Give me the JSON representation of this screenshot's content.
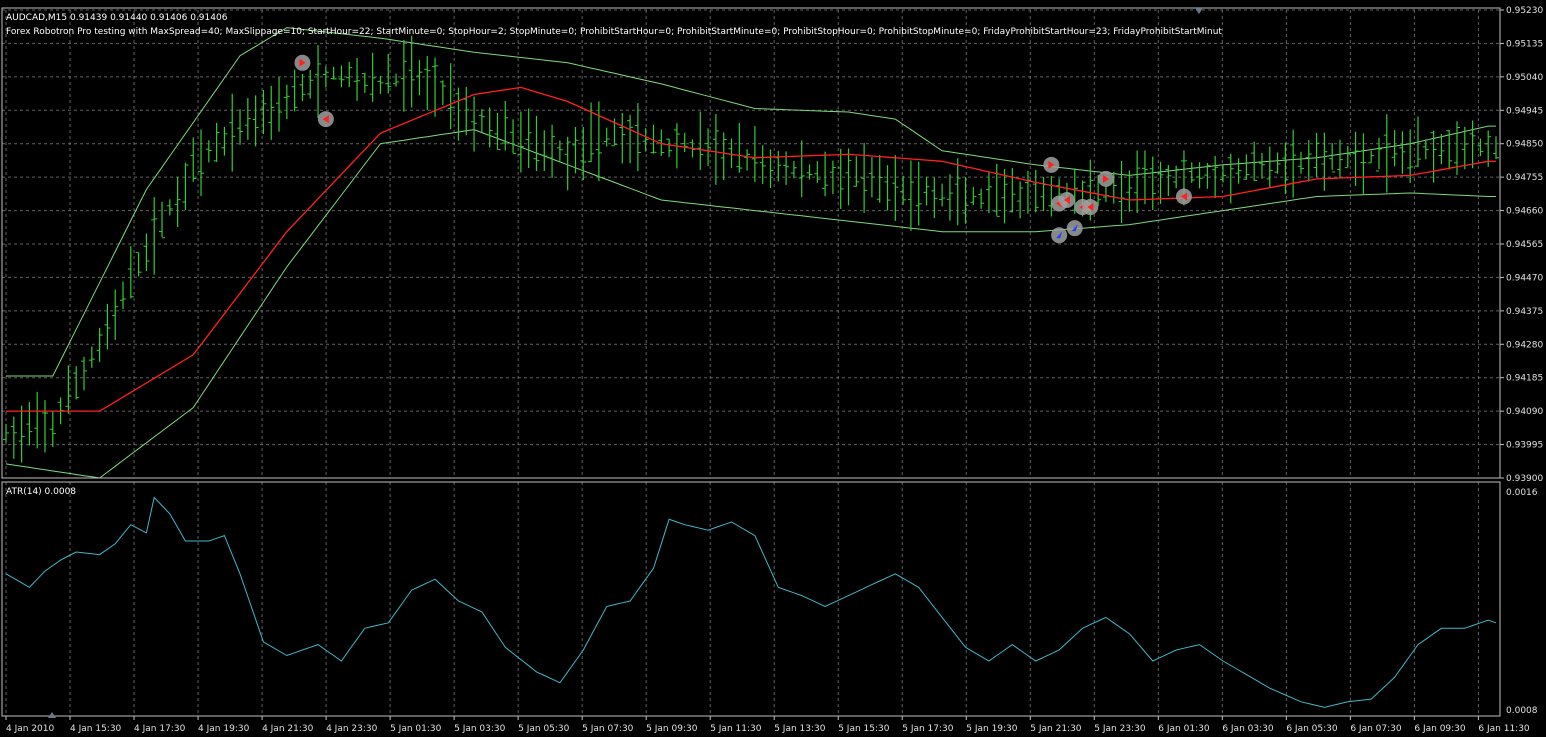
{
  "header": {
    "symbol_line": "AUDCAD,M15  0.91439 0.91440 0.91406 0.91406",
    "ea_line": "Forex Robotron Pro testing with MaxSpread=40; MaxSlippage=10; StartHour=22; StartMinute=0; StopHour=2; StopMinute=0; ProhibitStartHour=0; ProhibitStartMinute=0; ProhibitStopHour=0; ProhibitStopMinute=0; FridayProhibitStartHour=23; FridayProhibitStartMinut"
  },
  "colors": {
    "background": "#000000",
    "bars": "#32cd32",
    "bands": "#7fd87f",
    "moving_average": "#ff2020",
    "atr": "#3fb8c8",
    "grid": "#8a8a8a",
    "text": "#e0e0e0"
  },
  "chart_data": [
    {
      "type": "bar",
      "name": "price",
      "ylim": [
        0.939,
        0.9523
      ],
      "y_ticks": [
        "0.95230",
        "0.95135",
        "0.95040",
        "0.94945",
        "0.94850",
        "0.94755",
        "0.94660",
        "0.94565",
        "0.94470",
        "0.94375",
        "0.94280",
        "0.94185",
        "0.94090",
        "0.93995",
        "0.93900"
      ],
      "x_ticks": [
        "4 Jan 2010",
        "4 Jan 15:30",
        "4 Jan 17:30",
        "4 Jan 19:30",
        "4 Jan 21:30",
        "4 Jan 23:30",
        "5 Jan 01:30",
        "5 Jan 03:30",
        "5 Jan 05:30",
        "5 Jan 07:30",
        "5 Jan 09:30",
        "5 Jan 11:30",
        "5 Jan 13:30",
        "5 Jan 15:30",
        "5 Jan 17:30",
        "5 Jan 19:30",
        "5 Jan 21:30",
        "5 Jan 23:30",
        "6 Jan 01:30",
        "6 Jan 03:30",
        "6 Jan 05:30",
        "6 Jan 07:30",
        "6 Jan 09:30",
        "6 Jan 11:30"
      ],
      "close_anchors": [
        [
          0,
          0.9402
        ],
        [
          6,
          0.9405
        ],
        [
          12,
          0.9428
        ],
        [
          18,
          0.9455
        ],
        [
          24,
          0.9478
        ],
        [
          30,
          0.949
        ],
        [
          36,
          0.9498
        ],
        [
          42,
          0.9505
        ],
        [
          48,
          0.9502
        ],
        [
          52,
          0.9505
        ],
        [
          56,
          0.95
        ],
        [
          60,
          0.9492
        ],
        [
          66,
          0.9486
        ],
        [
          72,
          0.9482
        ],
        [
          78,
          0.9488
        ],
        [
          84,
          0.9485
        ],
        [
          90,
          0.9484
        ],
        [
          96,
          0.948
        ],
        [
          102,
          0.9477
        ],
        [
          108,
          0.9476
        ],
        [
          114,
          0.9472
        ],
        [
          120,
          0.947
        ],
        [
          126,
          0.9469
        ],
        [
          132,
          0.947
        ],
        [
          138,
          0.9471
        ],
        [
          144,
          0.9472
        ],
        [
          150,
          0.9476
        ],
        [
          156,
          0.9477
        ],
        [
          162,
          0.9479
        ],
        [
          168,
          0.948
        ],
        [
          174,
          0.9481
        ],
        [
          180,
          0.9483
        ],
        [
          186,
          0.9485
        ],
        [
          190,
          0.9484
        ]
      ],
      "ma_anchors": [
        [
          0,
          0.9409
        ],
        [
          12,
          0.9409
        ],
        [
          24,
          0.9425
        ],
        [
          36,
          0.946
        ],
        [
          48,
          0.9488
        ],
        [
          60,
          0.9499
        ],
        [
          66,
          0.9501
        ],
        [
          72,
          0.9497
        ],
        [
          84,
          0.9485
        ],
        [
          96,
          0.9481
        ],
        [
          108,
          0.9482
        ],
        [
          120,
          0.948
        ],
        [
          132,
          0.9474
        ],
        [
          144,
          0.9469
        ],
        [
          156,
          0.947
        ],
        [
          168,
          0.9475
        ],
        [
          180,
          0.9476
        ],
        [
          190,
          0.948
        ]
      ],
      "upper_band_anchors": [
        [
          0,
          0.9419
        ],
        [
          6,
          0.9419
        ],
        [
          18,
          0.9472
        ],
        [
          30,
          0.951
        ],
        [
          36,
          0.9518
        ],
        [
          48,
          0.9515
        ],
        [
          60,
          0.9511
        ],
        [
          72,
          0.9508
        ],
        [
          84,
          0.9502
        ],
        [
          96,
          0.9495
        ],
        [
          108,
          0.9494
        ],
        [
          114,
          0.9492
        ],
        [
          120,
          0.9483
        ],
        [
          132,
          0.9479
        ],
        [
          144,
          0.9476
        ],
        [
          156,
          0.9479
        ],
        [
          168,
          0.9481
        ],
        [
          180,
          0.9485
        ],
        [
          190,
          0.949
        ]
      ],
      "lower_band_anchors": [
        [
          0,
          0.9394
        ],
        [
          12,
          0.939
        ],
        [
          24,
          0.941
        ],
        [
          36,
          0.945
        ],
        [
          48,
          0.9485
        ],
        [
          60,
          0.9489
        ],
        [
          72,
          0.9479
        ],
        [
          84,
          0.9469
        ],
        [
          96,
          0.9466
        ],
        [
          108,
          0.9463
        ],
        [
          120,
          0.946
        ],
        [
          132,
          0.946
        ],
        [
          144,
          0.9462
        ],
        [
          156,
          0.9466
        ],
        [
          168,
          0.947
        ],
        [
          180,
          0.9471
        ],
        [
          190,
          0.947
        ]
      ],
      "trade_arrows": [
        {
          "bar": 38,
          "price": 0.9508,
          "kind": "buy-close"
        },
        {
          "bar": 41,
          "price": 0.9492,
          "kind": "sell-close"
        },
        {
          "bar": 134,
          "price": 0.9479,
          "kind": "buy-close"
        },
        {
          "bar": 135,
          "price": 0.9468,
          "kind": "sell-close"
        },
        {
          "bar": 136,
          "price": 0.9469,
          "kind": "sell-close"
        },
        {
          "bar": 138,
          "price": 0.9467,
          "kind": "sell-close"
        },
        {
          "bar": 139,
          "price": 0.9467,
          "kind": "sell-close"
        },
        {
          "bar": 141,
          "price": 0.9475,
          "kind": "buy-close"
        },
        {
          "bar": 151,
          "price": 0.947,
          "kind": "sell-close"
        },
        {
          "bar": 135,
          "price": 0.9459,
          "kind": "buy-open"
        },
        {
          "bar": 137,
          "price": 0.9461,
          "kind": "buy-open"
        }
      ]
    },
    {
      "type": "line",
      "title": "ATR(14) 0.0008",
      "ylim": [
        0.0008,
        0.0016
      ],
      "y_ticks": [
        "0.0016",
        "0.0008"
      ],
      "anchors": [
        [
          0,
          0.0013
        ],
        [
          3,
          0.00125
        ],
        [
          5,
          0.00131
        ],
        [
          7,
          0.00135
        ],
        [
          9,
          0.00138
        ],
        [
          12,
          0.00137
        ],
        [
          14,
          0.00141
        ],
        [
          16,
          0.00148
        ],
        [
          18,
          0.00145
        ],
        [
          19,
          0.00158
        ],
        [
          21,
          0.00152
        ],
        [
          23,
          0.00142
        ],
        [
          26,
          0.00142
        ],
        [
          28,
          0.00144
        ],
        [
          30,
          0.0013
        ],
        [
          33,
          0.00105
        ],
        [
          36,
          0.001
        ],
        [
          40,
          0.00104
        ],
        [
          43,
          0.00098
        ],
        [
          46,
          0.0011
        ],
        [
          49,
          0.00112
        ],
        [
          52,
          0.00124
        ],
        [
          55,
          0.00128
        ],
        [
          58,
          0.0012
        ],
        [
          61,
          0.00116
        ],
        [
          64,
          0.00103
        ],
        [
          68,
          0.00094
        ],
        [
          71,
          0.0009
        ],
        [
          74,
          0.00102
        ],
        [
          77,
          0.00118
        ],
        [
          80,
          0.0012
        ],
        [
          83,
          0.00132
        ],
        [
          85,
          0.0015
        ],
        [
          87,
          0.00148
        ],
        [
          90,
          0.00146
        ],
        [
          93,
          0.00149
        ],
        [
          96,
          0.00144
        ],
        [
          99,
          0.00125
        ],
        [
          102,
          0.00122
        ],
        [
          105,
          0.00118
        ],
        [
          108,
          0.00122
        ],
        [
          111,
          0.00126
        ],
        [
          114,
          0.0013
        ],
        [
          117,
          0.00125
        ],
        [
          120,
          0.00114
        ],
        [
          123,
          0.00103
        ],
        [
          126,
          0.00098
        ],
        [
          129,
          0.00104
        ],
        [
          132,
          0.00098
        ],
        [
          135,
          0.00102
        ],
        [
          138,
          0.0011
        ],
        [
          141,
          0.00114
        ],
        [
          144,
          0.00108
        ],
        [
          147,
          0.00098
        ],
        [
          150,
          0.00102
        ],
        [
          153,
          0.00104
        ],
        [
          156,
          0.00098
        ],
        [
          159,
          0.00093
        ],
        [
          162,
          0.00088
        ],
        [
          166,
          0.00083
        ],
        [
          169,
          0.00081
        ],
        [
          172,
          0.00083
        ],
        [
          175,
          0.00084
        ],
        [
          178,
          0.00092
        ],
        [
          181,
          0.00104
        ],
        [
          184,
          0.0011
        ],
        [
          187,
          0.0011
        ],
        [
          190,
          0.00113
        ],
        [
          192,
          0.00111
        ]
      ]
    }
  ]
}
